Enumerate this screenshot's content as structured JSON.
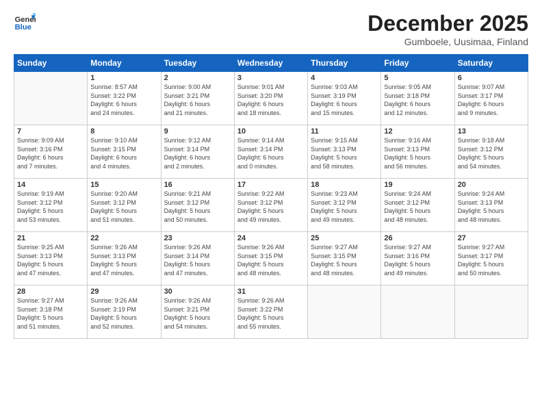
{
  "header": {
    "logo_line1": "General",
    "logo_line2": "Blue",
    "month": "December 2025",
    "location": "Gumboele, Uusimaa, Finland"
  },
  "weekdays": [
    "Sunday",
    "Monday",
    "Tuesday",
    "Wednesday",
    "Thursday",
    "Friday",
    "Saturday"
  ],
  "weeks": [
    [
      {
        "day": "",
        "info": ""
      },
      {
        "day": "1",
        "info": "Sunrise: 8:57 AM\nSunset: 3:22 PM\nDaylight: 6 hours\nand 24 minutes."
      },
      {
        "day": "2",
        "info": "Sunrise: 9:00 AM\nSunset: 3:21 PM\nDaylight: 6 hours\nand 21 minutes."
      },
      {
        "day": "3",
        "info": "Sunrise: 9:01 AM\nSunset: 3:20 PM\nDaylight: 6 hours\nand 18 minutes."
      },
      {
        "day": "4",
        "info": "Sunrise: 9:03 AM\nSunset: 3:19 PM\nDaylight: 6 hours\nand 15 minutes."
      },
      {
        "day": "5",
        "info": "Sunrise: 9:05 AM\nSunset: 3:18 PM\nDaylight: 6 hours\nand 12 minutes."
      },
      {
        "day": "6",
        "info": "Sunrise: 9:07 AM\nSunset: 3:17 PM\nDaylight: 6 hours\nand 9 minutes."
      }
    ],
    [
      {
        "day": "7",
        "info": "Sunrise: 9:09 AM\nSunset: 3:16 PM\nDaylight: 6 hours\nand 7 minutes."
      },
      {
        "day": "8",
        "info": "Sunrise: 9:10 AM\nSunset: 3:15 PM\nDaylight: 6 hours\nand 4 minutes."
      },
      {
        "day": "9",
        "info": "Sunrise: 9:12 AM\nSunset: 3:14 PM\nDaylight: 6 hours\nand 2 minutes."
      },
      {
        "day": "10",
        "info": "Sunrise: 9:14 AM\nSunset: 3:14 PM\nDaylight: 6 hours\nand 0 minutes."
      },
      {
        "day": "11",
        "info": "Sunrise: 9:15 AM\nSunset: 3:13 PM\nDaylight: 5 hours\nand 58 minutes."
      },
      {
        "day": "12",
        "info": "Sunrise: 9:16 AM\nSunset: 3:13 PM\nDaylight: 5 hours\nand 56 minutes."
      },
      {
        "day": "13",
        "info": "Sunrise: 9:18 AM\nSunset: 3:12 PM\nDaylight: 5 hours\nand 54 minutes."
      }
    ],
    [
      {
        "day": "14",
        "info": "Sunrise: 9:19 AM\nSunset: 3:12 PM\nDaylight: 5 hours\nand 53 minutes."
      },
      {
        "day": "15",
        "info": "Sunrise: 9:20 AM\nSunset: 3:12 PM\nDaylight: 5 hours\nand 51 minutes."
      },
      {
        "day": "16",
        "info": "Sunrise: 9:21 AM\nSunset: 3:12 PM\nDaylight: 5 hours\nand 50 minutes."
      },
      {
        "day": "17",
        "info": "Sunrise: 9:22 AM\nSunset: 3:12 PM\nDaylight: 5 hours\nand 49 minutes."
      },
      {
        "day": "18",
        "info": "Sunrise: 9:23 AM\nSunset: 3:12 PM\nDaylight: 5 hours\nand 49 minutes."
      },
      {
        "day": "19",
        "info": "Sunrise: 9:24 AM\nSunset: 3:12 PM\nDaylight: 5 hours\nand 48 minutes."
      },
      {
        "day": "20",
        "info": "Sunrise: 9:24 AM\nSunset: 3:13 PM\nDaylight: 5 hours\nand 48 minutes."
      }
    ],
    [
      {
        "day": "21",
        "info": "Sunrise: 9:25 AM\nSunset: 3:13 PM\nDaylight: 5 hours\nand 47 minutes."
      },
      {
        "day": "22",
        "info": "Sunrise: 9:26 AM\nSunset: 3:13 PM\nDaylight: 5 hours\nand 47 minutes."
      },
      {
        "day": "23",
        "info": "Sunrise: 9:26 AM\nSunset: 3:14 PM\nDaylight: 5 hours\nand 47 minutes."
      },
      {
        "day": "24",
        "info": "Sunrise: 9:26 AM\nSunset: 3:15 PM\nDaylight: 5 hours\nand 48 minutes."
      },
      {
        "day": "25",
        "info": "Sunrise: 9:27 AM\nSunset: 3:15 PM\nDaylight: 5 hours\nand 48 minutes."
      },
      {
        "day": "26",
        "info": "Sunrise: 9:27 AM\nSunset: 3:16 PM\nDaylight: 5 hours\nand 49 minutes."
      },
      {
        "day": "27",
        "info": "Sunrise: 9:27 AM\nSunset: 3:17 PM\nDaylight: 5 hours\nand 50 minutes."
      }
    ],
    [
      {
        "day": "28",
        "info": "Sunrise: 9:27 AM\nSunset: 3:18 PM\nDaylight: 5 hours\nand 51 minutes."
      },
      {
        "day": "29",
        "info": "Sunrise: 9:26 AM\nSunset: 3:19 PM\nDaylight: 5 hours\nand 52 minutes."
      },
      {
        "day": "30",
        "info": "Sunrise: 9:26 AM\nSunset: 3:21 PM\nDaylight: 5 hours\nand 54 minutes."
      },
      {
        "day": "31",
        "info": "Sunrise: 9:26 AM\nSunset: 3:22 PM\nDaylight: 5 hours\nand 55 minutes."
      },
      {
        "day": "",
        "info": ""
      },
      {
        "day": "",
        "info": ""
      },
      {
        "day": "",
        "info": ""
      }
    ]
  ]
}
